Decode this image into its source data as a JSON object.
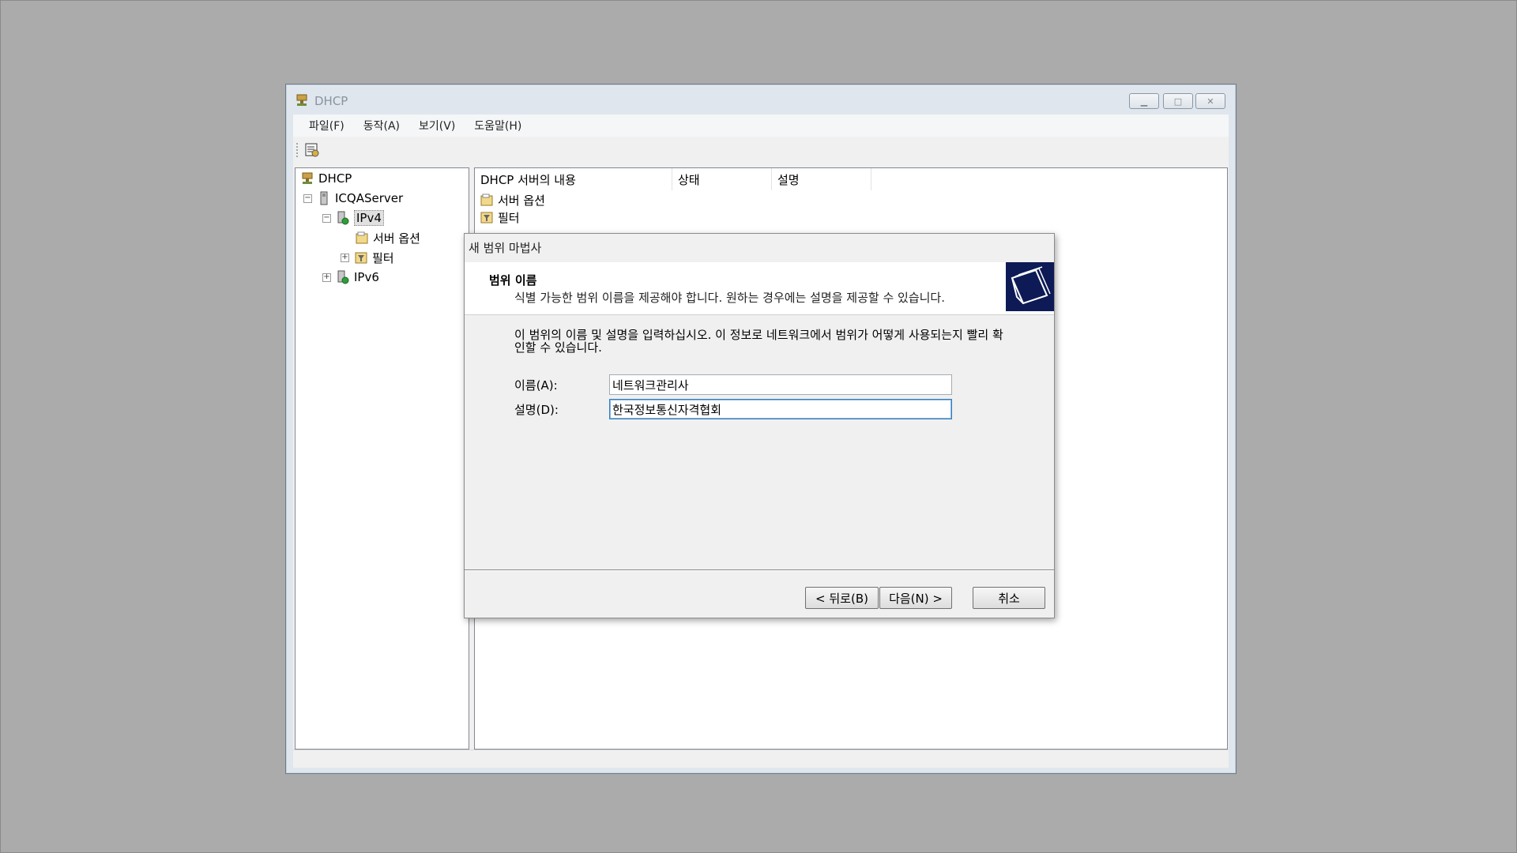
{
  "window": {
    "title": "DHCP"
  },
  "menu": [
    "파일(F)",
    "동작(A)",
    "보기(V)",
    "도움말(H)"
  ],
  "tree": {
    "root": "DHCP",
    "server": "ICQAServer",
    "ipv4": "IPv4",
    "server_options": "서버 옵션",
    "filters": "필터",
    "ipv6": "IPv6"
  },
  "list": {
    "columns": [
      "DHCP 서버의 내용",
      "상태",
      "설명"
    ],
    "rows": [
      "서버 옵션",
      "필터"
    ]
  },
  "dialog": {
    "title": "새 범위 마법사",
    "heading": "범위 이름",
    "subheading": "식별 가능한 범위 이름을 제공해야 합니다. 원하는 경우에는 설명을 제공할 수 있습니다.",
    "intro": "이 범위의 이름 및 설명을 입력하십시오. 이 정보로 네트워크에서 범위가 어떻게 사용되는지 빨리 확인할 수 있습니다.",
    "name_label": "이름(A):",
    "name_value": "네트워크관리사",
    "desc_label": "설명(D):",
    "desc_value": "한국정보통신자격협회",
    "back_button": "< 뒤로(B)",
    "next_button": "다음(N) >",
    "cancel_button": "취소"
  }
}
